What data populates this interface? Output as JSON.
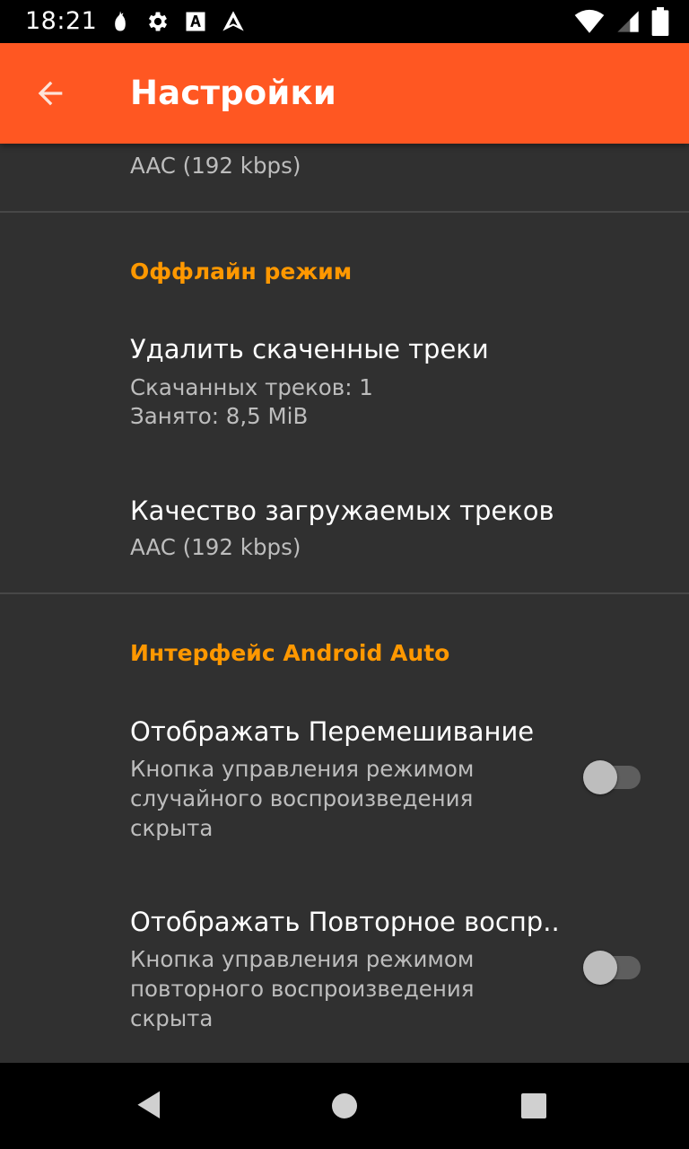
{
  "status_bar": {
    "time": "18:21",
    "icons": [
      "pear-icon",
      "gear-icon",
      "font-a-icon",
      "android-auto-icon",
      "wifi-icon",
      "signal-icon",
      "battery-icon"
    ]
  },
  "app_bar": {
    "title": "Настройки",
    "back_icon": "arrow-back-icon"
  },
  "colors": {
    "app_bar": "#FF5722",
    "accent": "#FF9800",
    "background": "#303030",
    "summary_text": "#bdbdbd"
  },
  "top_partial_item": {
    "summary": "AAC (192 kbps)"
  },
  "offline": {
    "category_title": "Оффлайн режим",
    "delete_tracks": {
      "title": "Удалить скаченные треки",
      "summary_line1": "Скачанных треков: 1",
      "summary_line2": "Занято: 8,5 MiB"
    },
    "download_quality": {
      "title": "Качество загружаемых треков",
      "summary": "AAC (192 kbps)"
    }
  },
  "android_auto": {
    "category_title": "Интерфейс Android Auto",
    "shuffle": {
      "title": "Отображать Перемешивание",
      "summary_line1": "Кнопка управления режимом",
      "summary_line2": "случайного воспроизведения",
      "summary_line3": "скрыта",
      "enabled": false
    },
    "repeat": {
      "title": "Отображать Повторное воспр..",
      "summary_line1": "Кнопка управления режимом",
      "summary_line2": "повторного воспроизведения",
      "summary_line3": "скрыта",
      "enabled": false
    }
  },
  "nav_bar": {
    "icons": [
      "back-triangle-icon",
      "home-circle-icon",
      "recents-square-icon"
    ]
  }
}
